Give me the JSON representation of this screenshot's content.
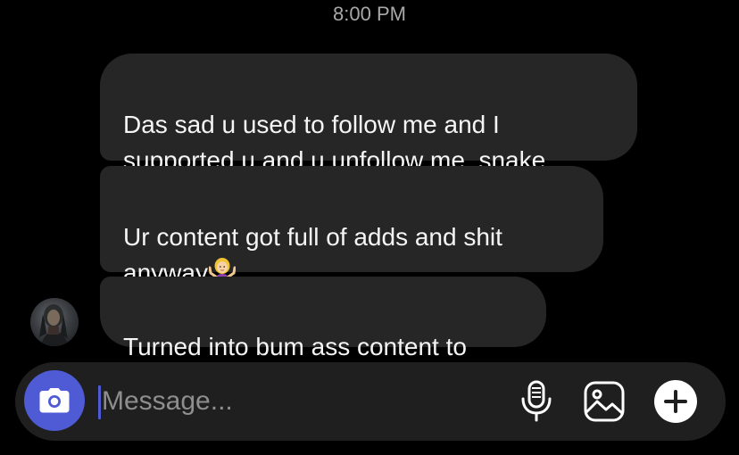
{
  "header": {
    "timestamp": "8:00 PM"
  },
  "messages": [
    {
      "text": "Das sad u used to follow me and I\nsupported u and u unfollow me, snake"
    },
    {
      "text": "Ur content got full of adds and shit\nanyway",
      "emoji": "person-shrugging-emoji"
    },
    {
      "text": "Turned into bum ass content to"
    }
  ],
  "composer": {
    "placeholder": "Message...",
    "value": ""
  },
  "icons": {
    "camera": "camera-icon",
    "mic": "microphone-icon",
    "gallery": "image-icon",
    "plus": "plus-icon"
  },
  "colors": {
    "background": "#000000",
    "bubble": "#262626",
    "composer": "#1f1f1f",
    "accent": "#4f5bd5",
    "timestamp": "#a8a8a8"
  }
}
